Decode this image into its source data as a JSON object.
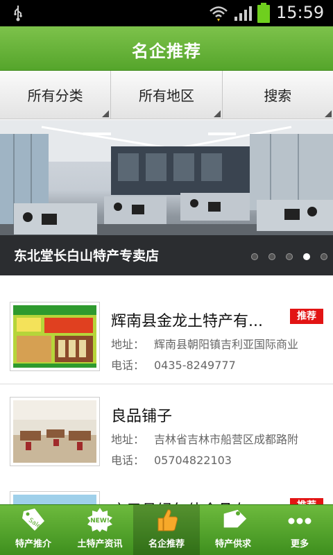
{
  "status": {
    "time": "15:59"
  },
  "header": {
    "title": "名企推荐"
  },
  "filters": [
    {
      "label": "所有分类"
    },
    {
      "label": "所有地区"
    },
    {
      "label": "搜索"
    }
  ],
  "banner": {
    "caption": "东北堂长白山特产专卖店",
    "slide_count": 5,
    "active_slide": 4
  },
  "companies": [
    {
      "name": "辉南县金龙土特产有...",
      "tag": "推荐",
      "address_label": "地址：",
      "address": "辉南县朝阳镇吉利亚国际商业",
      "phone_label": "电话：",
      "phone": "0435-8249777"
    },
    {
      "name": " 良品铺子",
      "tag": "",
      "address_label": "地址：",
      "address": "吉林省吉林市船营区成都路附",
      "phone_label": "电话：",
      "phone": "05704822103"
    },
    {
      "name": "庆元县绿尔佳食品有...",
      "tag": "推荐",
      "address_label": "",
      "address": "",
      "phone_label": "",
      "phone": ""
    }
  ],
  "nav": [
    {
      "label": "特产推介",
      "icon": "sale-tag-icon"
    },
    {
      "label": "土特产资讯",
      "icon": "new-badge-icon"
    },
    {
      "label": "名企推荐",
      "icon": "thumbs-up-icon",
      "active": true
    },
    {
      "label": "特产供求",
      "icon": "price-tag-icon"
    },
    {
      "label": "更多",
      "icon": "more-dots-icon"
    }
  ],
  "colors": {
    "accent": "#5aab2f",
    "tag": "#e21414"
  }
}
